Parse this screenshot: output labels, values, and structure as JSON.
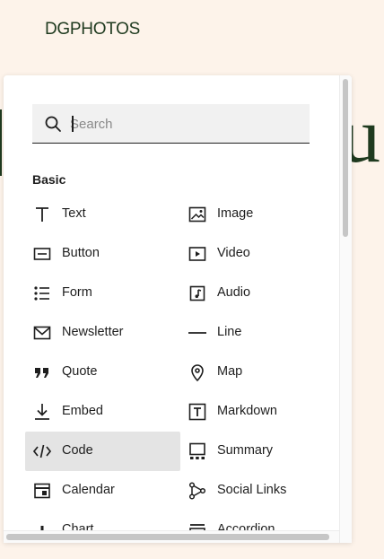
{
  "brand": "DGPHOTOS",
  "search": {
    "placeholder": "Search",
    "value": ""
  },
  "section": {
    "title": "Basic"
  },
  "items": [
    {
      "label": "Text",
      "icon": "text-icon"
    },
    {
      "label": "Image",
      "icon": "image-icon"
    },
    {
      "label": "Button",
      "icon": "button-icon"
    },
    {
      "label": "Video",
      "icon": "video-icon"
    },
    {
      "label": "Form",
      "icon": "form-icon"
    },
    {
      "label": "Audio",
      "icon": "audio-icon"
    },
    {
      "label": "Newsletter",
      "icon": "envelope-icon"
    },
    {
      "label": "Line",
      "icon": "line-icon"
    },
    {
      "label": "Quote",
      "icon": "quote-icon"
    },
    {
      "label": "Map",
      "icon": "map-pin-icon"
    },
    {
      "label": "Embed",
      "icon": "embed-icon"
    },
    {
      "label": "Markdown",
      "icon": "markdown-icon"
    },
    {
      "label": "Code",
      "icon": "code-icon",
      "active": true
    },
    {
      "label": "Summary",
      "icon": "summary-icon"
    },
    {
      "label": "Calendar",
      "icon": "calendar-icon"
    },
    {
      "label": "Social Links",
      "icon": "social-links-icon"
    },
    {
      "label": "Chart",
      "icon": "chart-icon"
    },
    {
      "label": "Accordion",
      "icon": "accordion-icon"
    }
  ],
  "colors": {
    "page_bg": "#fdf3ea",
    "brand_text": "#1f3a1f",
    "active_bg": "#e4e4e4",
    "text": "#1e1e1e"
  }
}
